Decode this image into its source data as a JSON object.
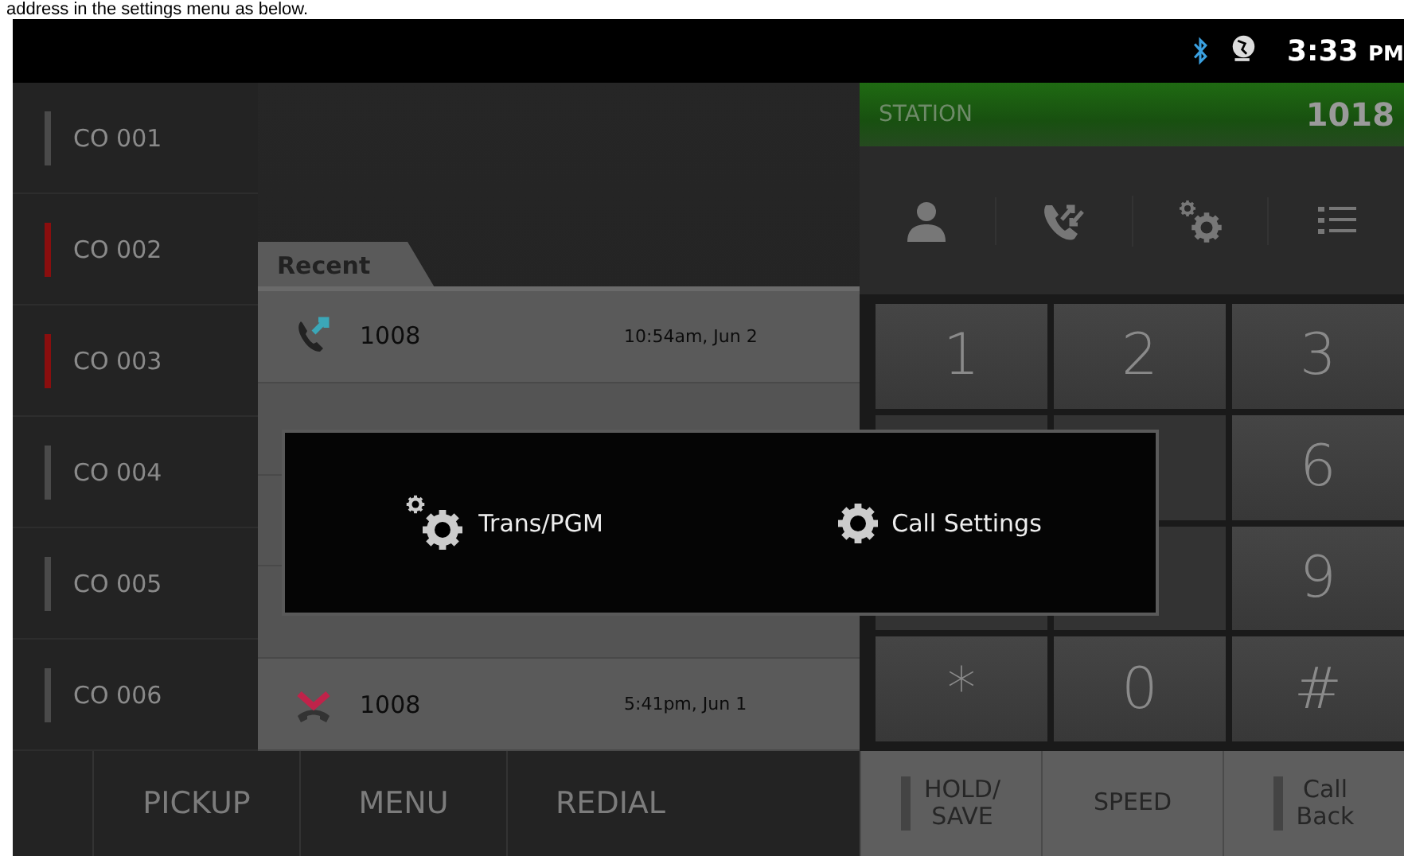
{
  "caption": "address in the settings menu as below.",
  "status_bar": {
    "time": "3:33",
    "ampm": "PM"
  },
  "lines": [
    {
      "label": "CO 001",
      "color": "#4a4a4a"
    },
    {
      "label": "CO 002",
      "color": "#8a0e0e"
    },
    {
      "label": "CO 003",
      "color": "#8a0e0e"
    },
    {
      "label": "CO 004",
      "color": "#4a4a4a"
    },
    {
      "label": "CO 005",
      "color": "#4a4a4a"
    },
    {
      "label": "CO 006",
      "color": "#4a4a4a"
    }
  ],
  "recent": {
    "tab": "Recent",
    "rows": [
      {
        "kind": "outgoing",
        "number": "1008",
        "time": "10:54am, Jun 2"
      },
      {
        "kind": "covered"
      },
      {
        "kind": "covered"
      },
      {
        "kind": "covered"
      },
      {
        "kind": "missed",
        "number": "1008",
        "time": "5:41pm, Jun 1"
      }
    ]
  },
  "station": {
    "label": "STATION",
    "number": "1018"
  },
  "toolbar": [
    {
      "kind": "contacts"
    },
    {
      "kind": "transfer"
    },
    {
      "kind": "settings"
    },
    {
      "kind": "list"
    }
  ],
  "keypad": [
    {
      "label": "1"
    },
    {
      "label": "2"
    },
    {
      "label": "3"
    },
    {
      "kind": "covered"
    },
    {
      "kind": "covered"
    },
    {
      "label": "6"
    },
    {
      "kind": "covered"
    },
    {
      "kind": "covered"
    },
    {
      "label": "9"
    },
    {
      "label": "*"
    },
    {
      "label": "0"
    },
    {
      "label": "#"
    }
  ],
  "soft_keys": [
    {
      "label": "PICKUP"
    },
    {
      "label": "MENU"
    },
    {
      "label": "REDIAL"
    }
  ],
  "function_keys": [
    {
      "label": "HOLD/\nSAVE",
      "indicator": true
    },
    {
      "label": "SPEED",
      "indicator": false
    },
    {
      "label": "Call\nBack",
      "indicator": true
    }
  ],
  "popup": [
    {
      "kind": "gears",
      "label": "Trans/PGM"
    },
    {
      "kind": "gear",
      "label": "Call Settings"
    }
  ]
}
